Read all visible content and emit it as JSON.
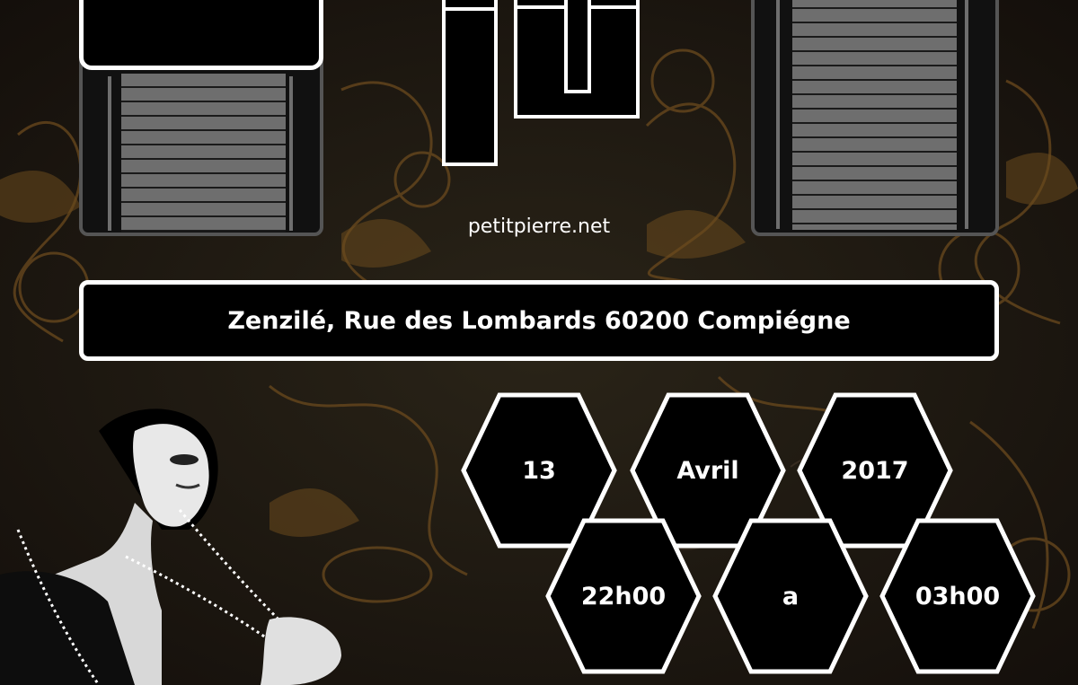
{
  "website": "petitpierre.net",
  "address": "Zenzilé, Rue des Lombards 60200 Compiégne",
  "date": {
    "day": "13",
    "month": "Avril",
    "year": "2017"
  },
  "time": {
    "start": "22h00",
    "separator": "a",
    "end": "03h00"
  },
  "colors": {
    "background": "#1a1410",
    "ornament": "#6b4a1e",
    "panel": "#000000",
    "outline": "#ffffff"
  },
  "icons": [
    "floppy-disk-icon",
    "floppy-disk-icon",
    "pp-logo-icon"
  ]
}
